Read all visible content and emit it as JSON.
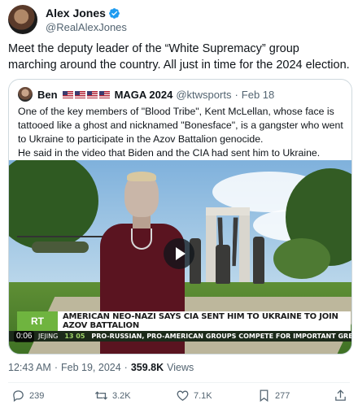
{
  "author": {
    "name": "Alex Jones",
    "handle": "@RealAlexJones",
    "verified_icon": "verified-badge-icon"
  },
  "tweet": {
    "text": "Meet the deputy leader of the “White Supremacy” group marching around the country. All just in time for the 2024 election."
  },
  "quote": {
    "name": "Ben",
    "flags": [
      "us-flag-icon",
      "us-flag-icon",
      "us-flag-icon",
      "us-flag-icon"
    ],
    "tag": "MAGA 2024",
    "handle": "@ktwsports",
    "date": "Feb 18",
    "text_line1": "One of the key members of \"Blood Tribe\", Kent McLellan, whose face is tattooed like a ghost and nicknamed \"Bonesface\", is a gangster who went to Ukraine to participate in the Azov Battalion genocide.",
    "text_line2": "He said in the video that Biden and the CIA had sent him to Ukraine.",
    "video": {
      "channel_logo": "RT",
      "chyron": "AMERICAN NEO-NAZI SAYS CIA SENT HIM TO UKRAINE TO JOIN AZOV BATTALION",
      "ticker_prefix": "JEJING",
      "ticker_time": "13 05",
      "ticker_text": "PRO-RUSSIAN, PRO-AMERICAN GROUPS COMPETE FOR IMPORTANT GREEK PORT",
      "duration": "0:06"
    }
  },
  "meta": {
    "time": "12:43 AM",
    "separator": "·",
    "date": "Feb 19, 2024",
    "views_count": "359.8K",
    "views_label": "Views"
  },
  "actions": {
    "replies": "239",
    "reposts": "3.2K",
    "likes": "7.1K",
    "bookmarks": "277"
  },
  "colors": {
    "text": "#0f1419",
    "secondary": "#536471",
    "verified": "#1d9bf0",
    "border": "#cfd9de"
  }
}
